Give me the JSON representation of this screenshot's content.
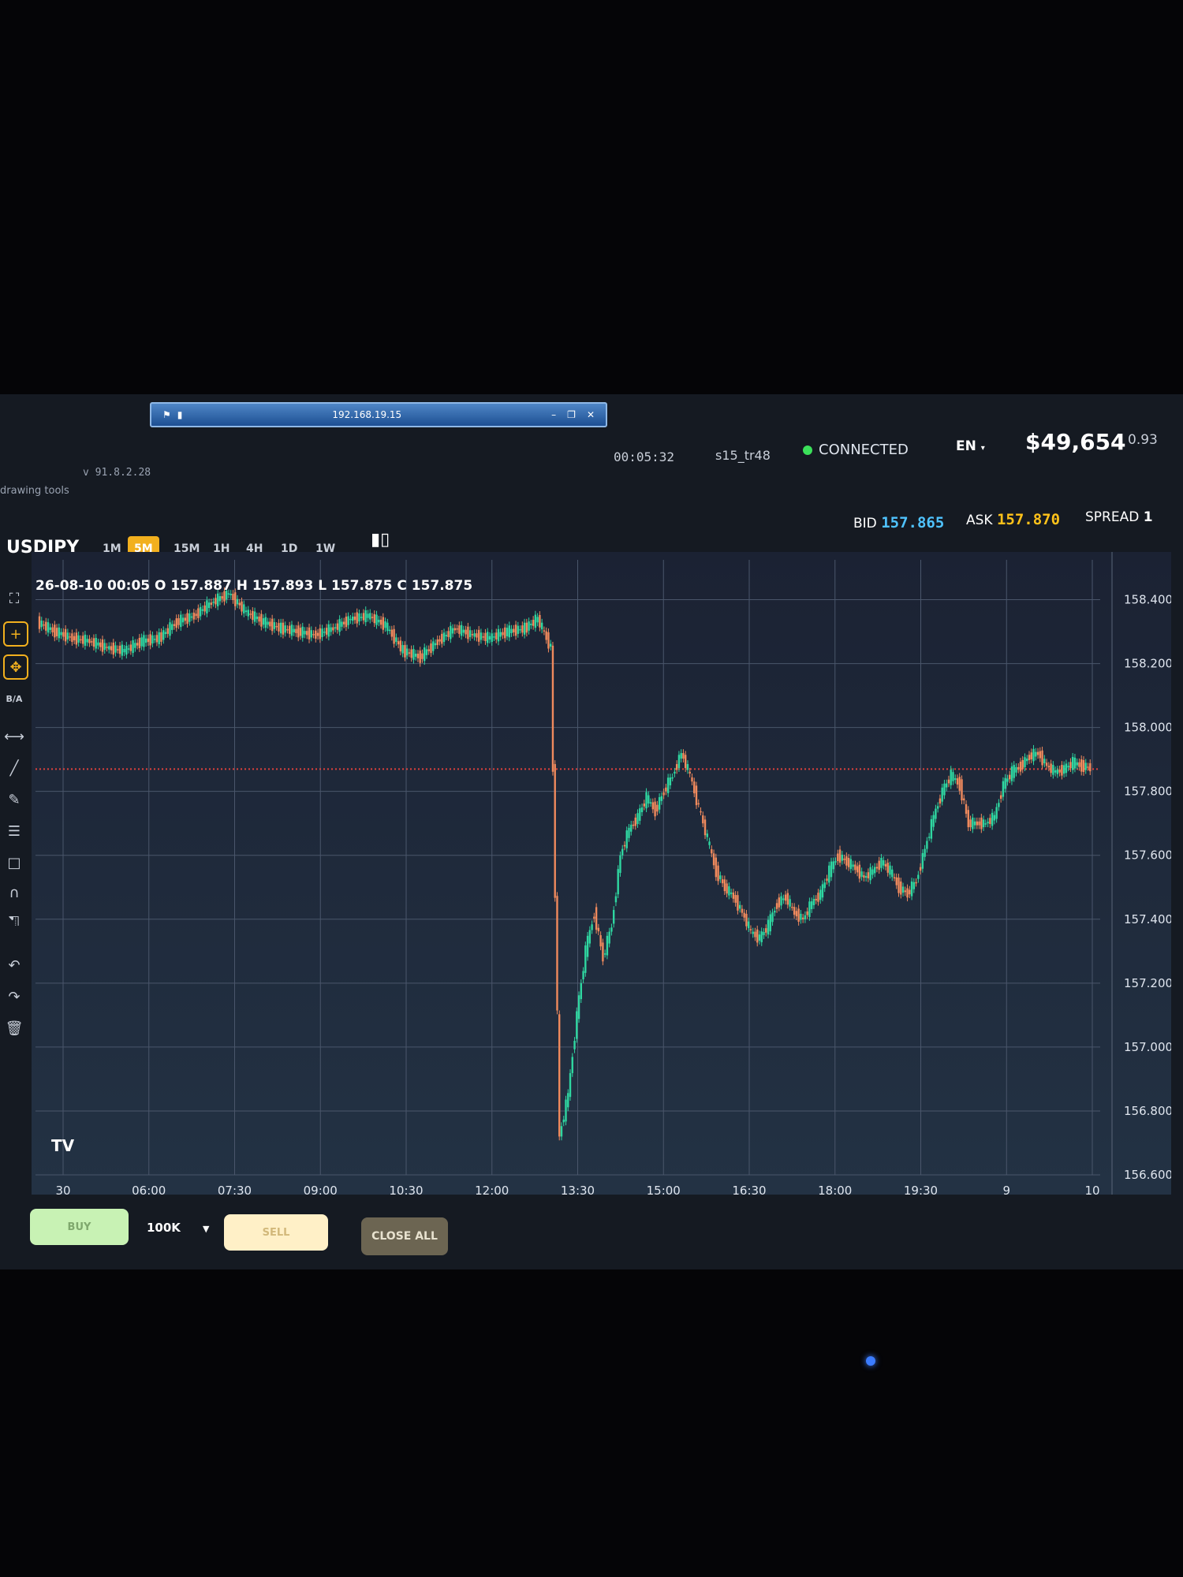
{
  "window": {
    "rdp_address": "192.168.19.15",
    "version": "v 91.8.2.28",
    "drawing_tools_label": "drawing tools"
  },
  "header": {
    "timer": "00:05:32",
    "user": "s15_tr48",
    "connection_status": "CONNECTED",
    "language": "EN",
    "balance": "$49,654",
    "balance_extra": "0.93"
  },
  "quote": {
    "symbol": "USDJPY",
    "bid_label": "BID",
    "bid": "157.865",
    "ask_label": "ASK",
    "ask": "157.870",
    "spread_label": "SPREAD",
    "spread": "1"
  },
  "timeframes": [
    "1M",
    "5M",
    "15M",
    "1H",
    "4H",
    "1D",
    "1W"
  ],
  "active_timeframe": "5M",
  "ohlc_line": "26-08-10 00:05 O 157.887 H 157.893 L 157.875 C 157.875",
  "toolbar_icons": [
    "fullscreen-icon",
    "crosshair-icon",
    "move-icon",
    "ba-text",
    "measure-icon",
    "line-icon",
    "pencil-icon",
    "fib-icon",
    "rectangle-icon",
    "magnet-icon",
    "lock-icon",
    "undo-icon",
    "redo-icon",
    "trash-icon"
  ],
  "toolbar_ba_label": "B/A",
  "bottom": {
    "buy_label": "BUY",
    "lot_size": "100K",
    "sell_label": "SELL",
    "close_all_label": "CLOSE ALL"
  },
  "colors": {
    "up": "#2fd7a1",
    "down": "#f08a5d",
    "active_tf": "#f2b01e",
    "bid": "#4fc3ff",
    "ask": "#ffc21a",
    "price_line": "#e0413c"
  },
  "chart_data": {
    "type": "candlestick",
    "y_ticks": [
      "158.400",
      "158.200",
      "158.000",
      "157.800",
      "157.600",
      "157.400",
      "157.200",
      "157.000",
      "156.800",
      "156.600"
    ],
    "ylim": [
      156.6,
      158.5
    ],
    "x_ticks": [
      "30",
      "06:00",
      "07:30",
      "09:00",
      "10:30",
      "12:00",
      "13:30",
      "15:00",
      "16:30",
      "18:00",
      "19:30",
      "9",
      "10"
    ],
    "current_price": 157.87,
    "close_path": [
      [
        0,
        158.33
      ],
      [
        8,
        158.3
      ],
      [
        16,
        158.28
      ],
      [
        24,
        158.27
      ],
      [
        32,
        158.25
      ],
      [
        40,
        158.24
      ],
      [
        48,
        158.27
      ],
      [
        56,
        158.28
      ],
      [
        64,
        158.33
      ],
      [
        72,
        158.35
      ],
      [
        80,
        158.39
      ],
      [
        88,
        158.42
      ],
      [
        96,
        158.36
      ],
      [
        104,
        158.33
      ],
      [
        112,
        158.31
      ],
      [
        120,
        158.3
      ],
      [
        128,
        158.29
      ],
      [
        136,
        158.31
      ],
      [
        144,
        158.34
      ],
      [
        152,
        158.35
      ],
      [
        160,
        158.32
      ],
      [
        168,
        158.24
      ],
      [
        176,
        158.22
      ],
      [
        184,
        158.27
      ],
      [
        192,
        158.31
      ],
      [
        200,
        158.29
      ],
      [
        208,
        158.28
      ],
      [
        216,
        158.3
      ],
      [
        224,
        158.31
      ],
      [
        230,
        158.34
      ],
      [
        236,
        158.25
      ],
      [
        240,
        156.72
      ],
      [
        244,
        156.85
      ],
      [
        248,
        157.1
      ],
      [
        252,
        157.3
      ],
      [
        256,
        157.42
      ],
      [
        260,
        157.28
      ],
      [
        264,
        157.38
      ],
      [
        268,
        157.6
      ],
      [
        272,
        157.68
      ],
      [
        276,
        157.72
      ],
      [
        280,
        157.78
      ],
      [
        284,
        157.74
      ],
      [
        288,
        157.8
      ],
      [
        292,
        157.85
      ],
      [
        296,
        157.92
      ],
      [
        300,
        157.85
      ],
      [
        304,
        157.75
      ],
      [
        308,
        157.65
      ],
      [
        312,
        157.55
      ],
      [
        316,
        157.5
      ],
      [
        320,
        157.47
      ],
      [
        324,
        157.42
      ],
      [
        328,
        157.36
      ],
      [
        332,
        157.34
      ],
      [
        336,
        157.38
      ],
      [
        340,
        157.45
      ],
      [
        344,
        157.47
      ],
      [
        348,
        157.42
      ],
      [
        352,
        157.4
      ],
      [
        356,
        157.45
      ],
      [
        360,
        157.48
      ],
      [
        364,
        157.55
      ],
      [
        368,
        157.6
      ],
      [
        372,
        157.58
      ],
      [
        376,
        157.56
      ],
      [
        380,
        157.53
      ],
      [
        384,
        157.55
      ],
      [
        388,
        157.58
      ],
      [
        392,
        157.55
      ],
      [
        396,
        157.5
      ],
      [
        400,
        157.48
      ],
      [
        404,
        157.52
      ],
      [
        408,
        157.62
      ],
      [
        412,
        157.72
      ],
      [
        416,
        157.8
      ],
      [
        420,
        157.85
      ],
      [
        424,
        157.82
      ],
      [
        428,
        157.7
      ],
      [
        432,
        157.7
      ],
      [
        436,
        157.7
      ],
      [
        440,
        157.72
      ],
      [
        444,
        157.82
      ],
      [
        448,
        157.86
      ],
      [
        452,
        157.88
      ],
      [
        456,
        157.91
      ],
      [
        460,
        157.92
      ],
      [
        464,
        157.88
      ],
      [
        468,
        157.86
      ],
      [
        472,
        157.87
      ],
      [
        476,
        157.89
      ],
      [
        480,
        157.88
      ],
      [
        484,
        157.875
      ]
    ]
  }
}
